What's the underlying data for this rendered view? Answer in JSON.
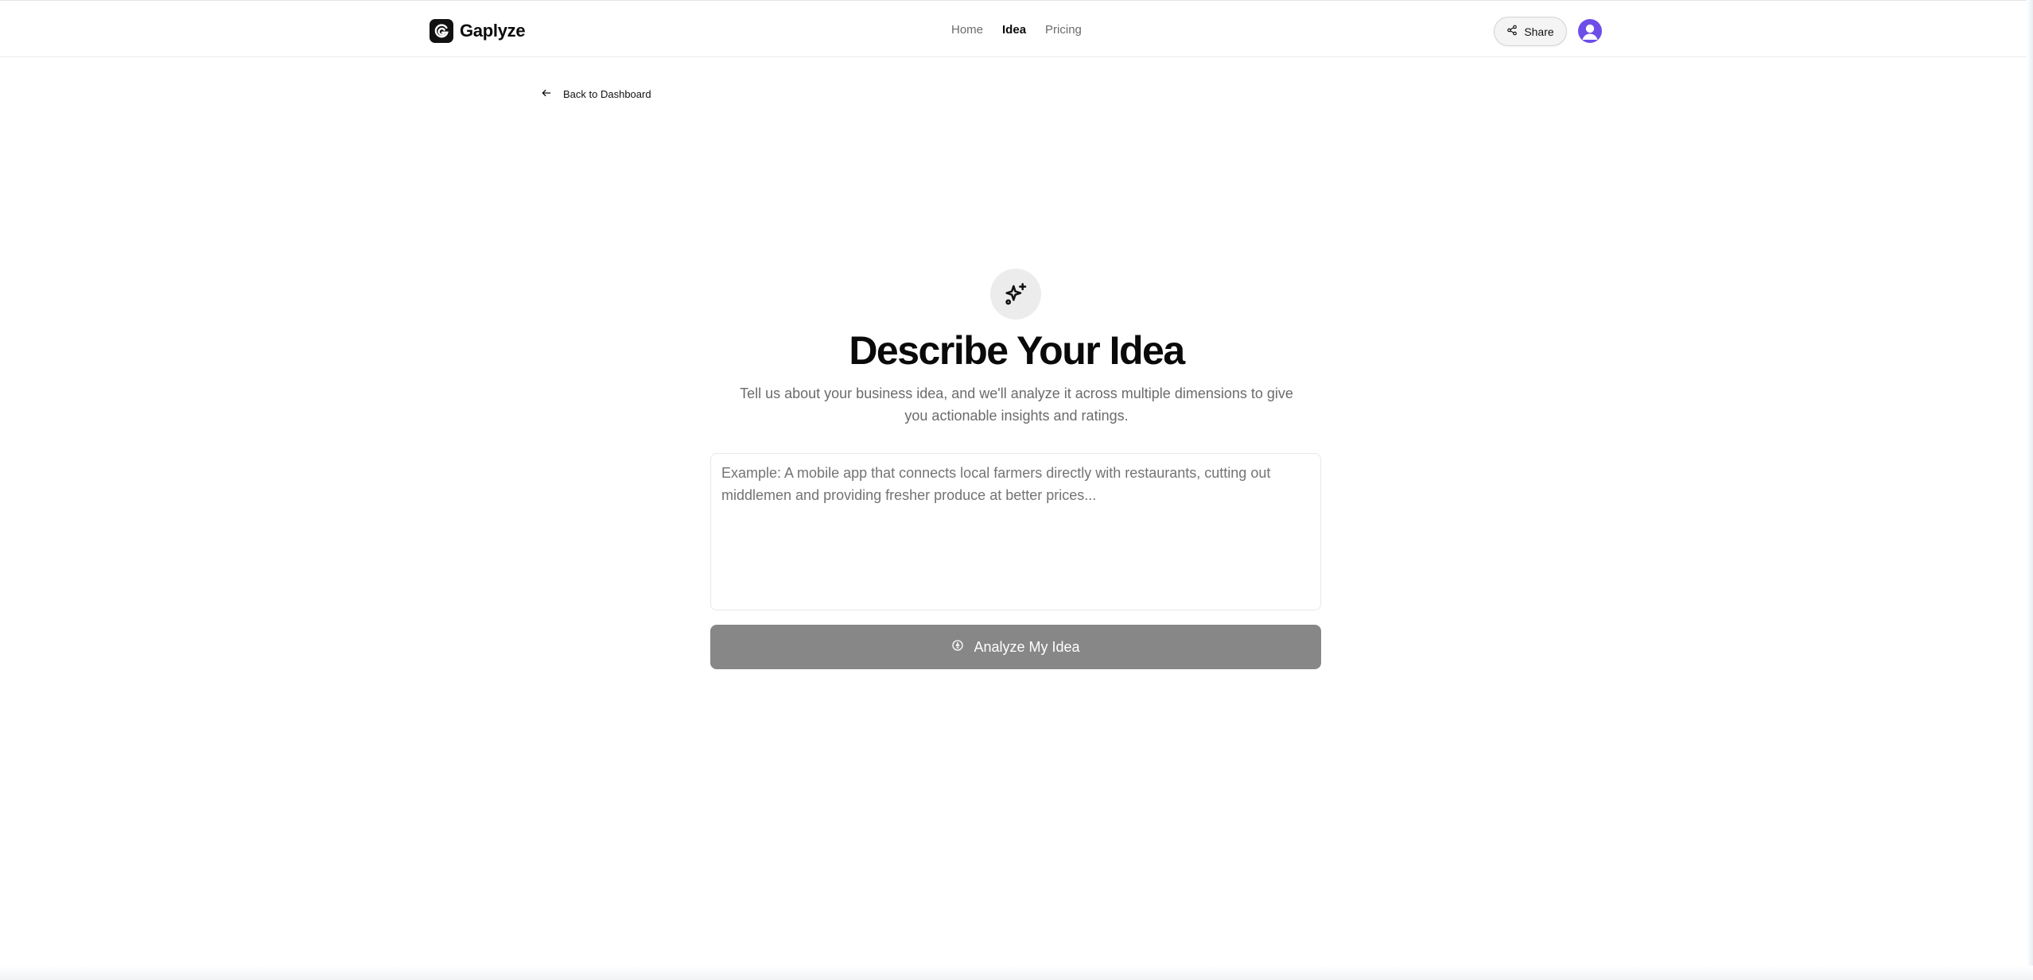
{
  "header": {
    "brand_name": "Gaplyze",
    "nav": [
      {
        "label": "Home",
        "active": false
      },
      {
        "label": "Idea",
        "active": true
      },
      {
        "label": "Pricing",
        "active": false
      }
    ],
    "share_label": "Share"
  },
  "back_link": {
    "label": "Back to Dashboard"
  },
  "hero": {
    "icon": "sparkles-icon",
    "title": "Describe Your Idea",
    "subtitle": "Tell us about your business idea, and we'll analyze it across multiple dimensions to give you actionable insights and ratings."
  },
  "idea_input": {
    "value": "",
    "placeholder": "Example: A mobile app that connects local farmers directly with restaurants, cutting out middlemen and providing fresher produce at better prices..."
  },
  "analyze_button": {
    "label": "Analyze My Idea",
    "icon": "lightbulb-icon"
  },
  "colors": {
    "accent_avatar": "#6d4ee8",
    "button_disabled": "#878787",
    "text_muted": "#6b6b6b"
  }
}
